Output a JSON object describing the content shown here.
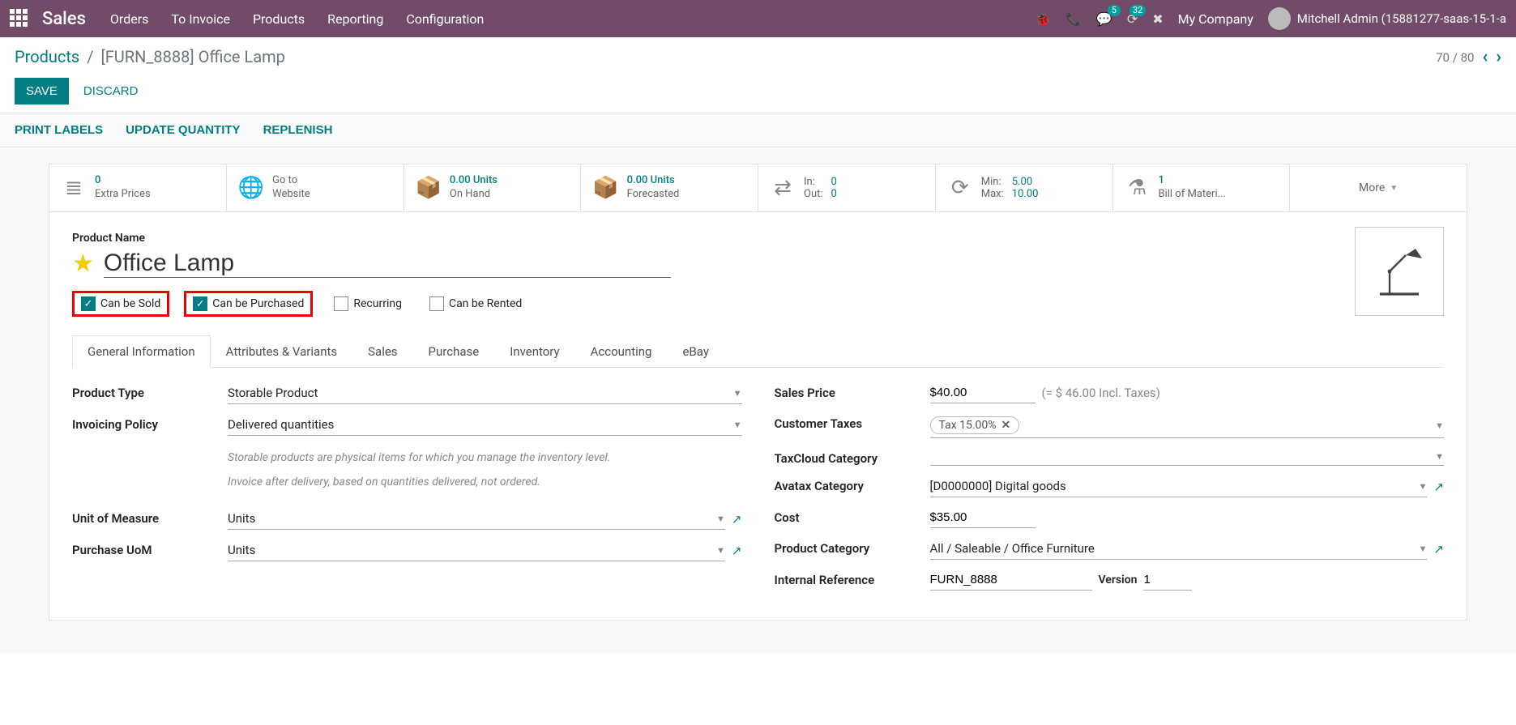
{
  "nav": {
    "brand": "Sales",
    "menu": [
      "Orders",
      "To Invoice",
      "Products",
      "Reporting",
      "Configuration"
    ],
    "badges": {
      "messages": "5",
      "activities": "32"
    },
    "company": "My Company",
    "user": "Mitchell Admin (15881277-saas-15-1-a"
  },
  "breadcrumb": {
    "root": "Products",
    "current": "[FURN_8888] Office Lamp"
  },
  "actions": {
    "save": "SAVE",
    "discard": "DISCARD"
  },
  "pager": {
    "text": "70 / 80"
  },
  "subactions": [
    "PRINT LABELS",
    "UPDATE QUANTITY",
    "REPLENISH"
  ],
  "stats": {
    "extra_prices": {
      "count": "0",
      "label": "Extra Prices"
    },
    "website": {
      "line1": "Go to",
      "line2": "Website"
    },
    "onhand": {
      "value": "0.00 Units",
      "label": "On Hand"
    },
    "forecast": {
      "value": "0.00 Units",
      "label": "Forecasted"
    },
    "inout": {
      "in_label": "In:",
      "in_val": "0",
      "out_label": "Out:",
      "out_val": "0"
    },
    "minmax": {
      "min_label": "Min:",
      "min_val": "5.00",
      "max_label": "Max:",
      "max_val": "10.00"
    },
    "bom": {
      "count": "1",
      "label": "Bill of Materi..."
    },
    "more": "More"
  },
  "form": {
    "name_label": "Product Name",
    "name": "Office Lamp",
    "checks": {
      "sold": {
        "label": "Can be Sold",
        "checked": true
      },
      "purchased": {
        "label": "Can be Purchased",
        "checked": true
      },
      "recurring": {
        "label": "Recurring",
        "checked": false
      },
      "rented": {
        "label": "Can be Rented",
        "checked": false
      }
    }
  },
  "tabs": [
    "General Information",
    "Attributes & Variants",
    "Sales",
    "Purchase",
    "Inventory",
    "Accounting",
    "eBay"
  ],
  "fields_left": {
    "product_type": {
      "label": "Product Type",
      "value": "Storable Product"
    },
    "invoicing_policy": {
      "label": "Invoicing Policy",
      "value": "Delivered quantities"
    },
    "help1": "Storable products are physical items for which you manage the inventory level.",
    "help2": "Invoice after delivery, based on quantities delivered, not ordered.",
    "uom": {
      "label": "Unit of Measure",
      "value": "Units"
    },
    "purchase_uom": {
      "label": "Purchase UoM",
      "value": "Units"
    }
  },
  "fields_right": {
    "sales_price": {
      "label": "Sales Price",
      "value": "$40.00",
      "note": "(= $ 46.00 Incl. Taxes)"
    },
    "customer_taxes": {
      "label": "Customer Taxes",
      "tag": "Tax 15.00%"
    },
    "taxcloud": {
      "label": "TaxCloud Category",
      "value": ""
    },
    "avatax": {
      "label": "Avatax Category",
      "value": "[D0000000] Digital goods"
    },
    "cost": {
      "label": "Cost",
      "value": "$35.00"
    },
    "category": {
      "label": "Product Category",
      "value": "All / Saleable / Office Furniture"
    },
    "internal_ref": {
      "label": "Internal Reference",
      "value": "FURN_8888"
    },
    "version": {
      "label": "Version",
      "value": "1"
    }
  }
}
